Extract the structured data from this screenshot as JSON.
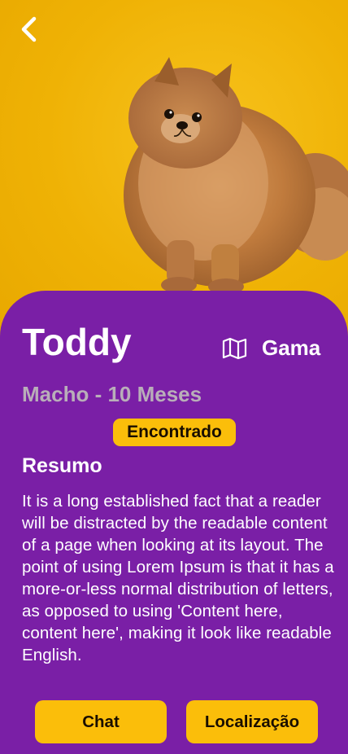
{
  "pet": {
    "name": "Toddy",
    "subtitle": "Macho - 10 Meses",
    "location": "Gama",
    "status": "Encontrado"
  },
  "summary": {
    "title": "Resumo",
    "text": "It is a long established fact that a reader will be distracted by the readable content of a page when looking at its layout. The point of using Lorem Ipsum is that it has a more-or-less normal distribution of letters, as opposed to using 'Content here, content here', making it  look like readable English."
  },
  "actions": {
    "chat_label": "Chat",
    "location_label": "Localização"
  },
  "icons": {
    "back": "chevron-left-icon",
    "map": "map-icon"
  },
  "colors": {
    "background": "#f2b708",
    "card": "#7a1fa6",
    "accent": "#fbbe0a",
    "subtitle": "#b9aeb9",
    "text": "#ffffff"
  }
}
